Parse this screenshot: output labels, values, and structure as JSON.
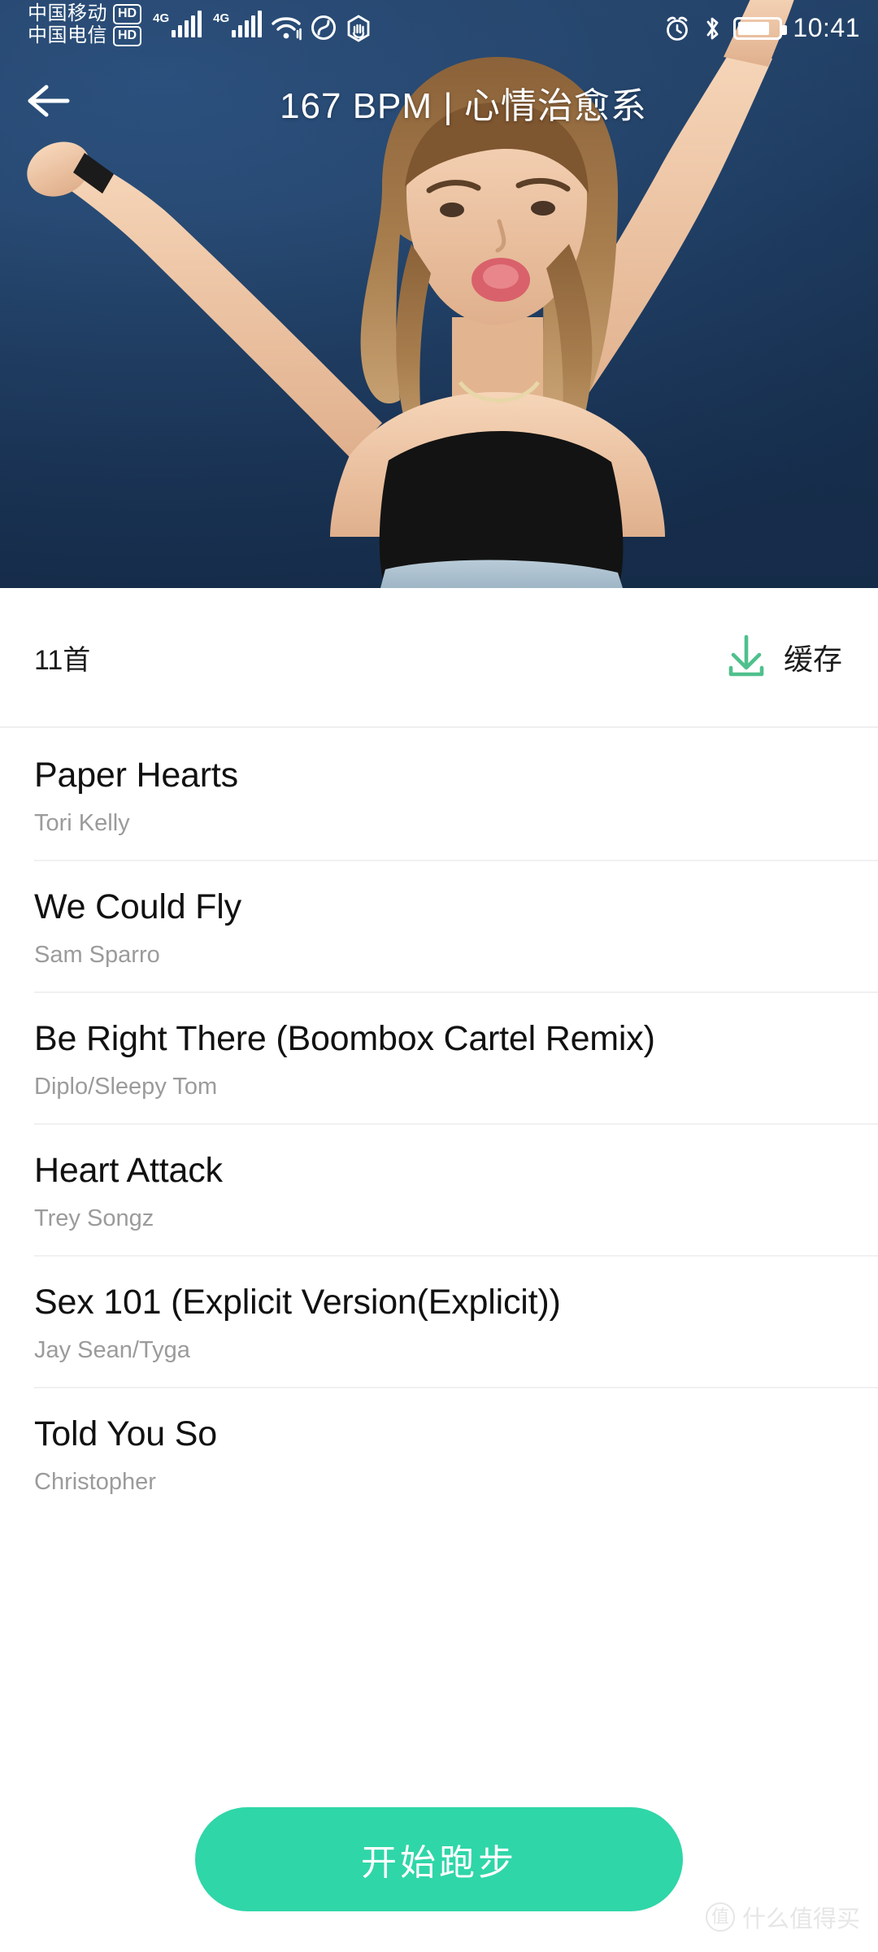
{
  "status_bar": {
    "carrier_primary": "中国移动",
    "carrier_primary_badge": "HD",
    "carrier_secondary": "中国电信",
    "carrier_secondary_badge": "HD",
    "network_primary": "4G",
    "network_secondary": "4G",
    "icons": [
      "wifi-icon",
      "do-not-disturb-icon",
      "touch-disabled-icon",
      "alarm-icon",
      "bluetooth-icon",
      "battery-icon"
    ],
    "time": "10:41"
  },
  "header": {
    "back_label": "←",
    "title": "167 BPM | 心情治愈系"
  },
  "meta": {
    "count_label": "11首",
    "cache_label": "缓存",
    "cache_icon": "download-icon",
    "accent_green": "#4fc08d"
  },
  "songs": [
    {
      "title": "Paper Hearts",
      "artist": "Tori Kelly"
    },
    {
      "title": "We Could Fly",
      "artist": "Sam Sparro"
    },
    {
      "title": "Be Right There (Boombox Cartel Remix)",
      "artist": "Diplo/Sleepy Tom"
    },
    {
      "title": "Heart Attack",
      "artist": "Trey Songz"
    },
    {
      "title": "Sex 101 (Explicit Version(Explicit))",
      "artist": "Jay Sean/Tyga"
    },
    {
      "title": "Told You So",
      "artist": "Christopher"
    }
  ],
  "footer": {
    "start_button_label": "开始跑步",
    "button_color": "#2fd6a8"
  },
  "watermark": {
    "mark": "值",
    "text": "什么值得买"
  }
}
